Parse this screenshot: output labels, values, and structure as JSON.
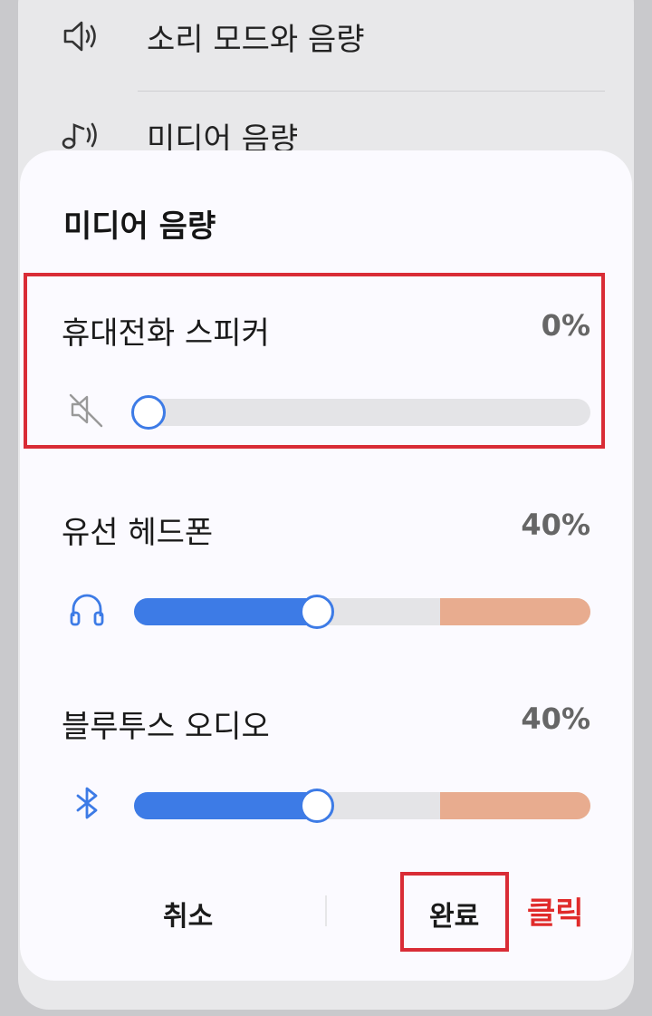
{
  "background": {
    "rows": [
      {
        "label": "소리 모드와 음량",
        "icon": "speaker-icon"
      },
      {
        "label": "미디어 음량",
        "icon": "music-note-icon"
      }
    ]
  },
  "dialog": {
    "title": "미디어 음량",
    "sections": [
      {
        "label": "휴대전화 스피커",
        "percent_text": "0%",
        "value": 0,
        "icon": "speaker-muted-icon",
        "warning_from": null
      },
      {
        "label": "유선 헤드폰",
        "percent_text": "40%",
        "value": 0.4,
        "icon": "headphones-icon",
        "warning_from": 0.67
      },
      {
        "label": "블루투스 오디오",
        "percent_text": "40%",
        "value": 0.4,
        "icon": "bluetooth-icon",
        "warning_from": 0.67
      }
    ],
    "buttons": {
      "cancel": "취소",
      "done": "완료"
    }
  },
  "annotation": {
    "click_note": "클릭"
  },
  "colors": {
    "accent": "#3d7be6",
    "warning": "#e8ac8f",
    "highlight": "#d92c36"
  }
}
